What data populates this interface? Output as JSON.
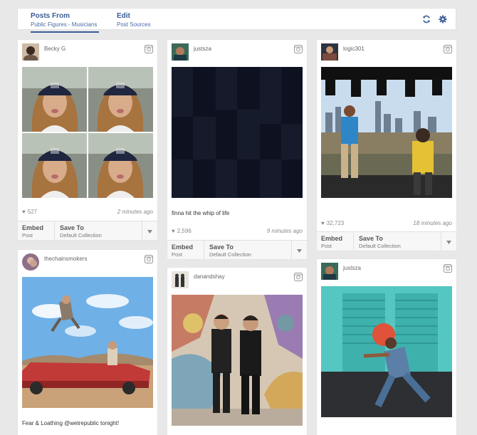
{
  "header": {
    "tabs": [
      {
        "title": "Posts From",
        "subtitle": "Public Figures - Musicians"
      },
      {
        "title": "Edit",
        "subtitle": "Post Sources"
      }
    ],
    "icons": [
      "refresh-icon",
      "gear-icon"
    ],
    "accent": "#3a5a95"
  },
  "actions": {
    "embed": "Embed",
    "embed_sub": "Post",
    "save": "Save To",
    "save_sub": "Default Collection"
  },
  "posts": [
    {
      "user": "Becky G",
      "likes": "527",
      "time": "2 minutes ago"
    },
    {
      "user": "thechainsmokers",
      "caption": "Fear & Loathing @wetrepublic tonight!"
    },
    {
      "user": "justsza",
      "caption": "finna hit the whip of life",
      "likes": "2,596",
      "time": "9 minutes ago"
    },
    {
      "user": "danandshay"
    },
    {
      "user": "logic301",
      "likes": "32,723",
      "time": "18 minutes ago"
    },
    {
      "user": "justsza"
    }
  ]
}
